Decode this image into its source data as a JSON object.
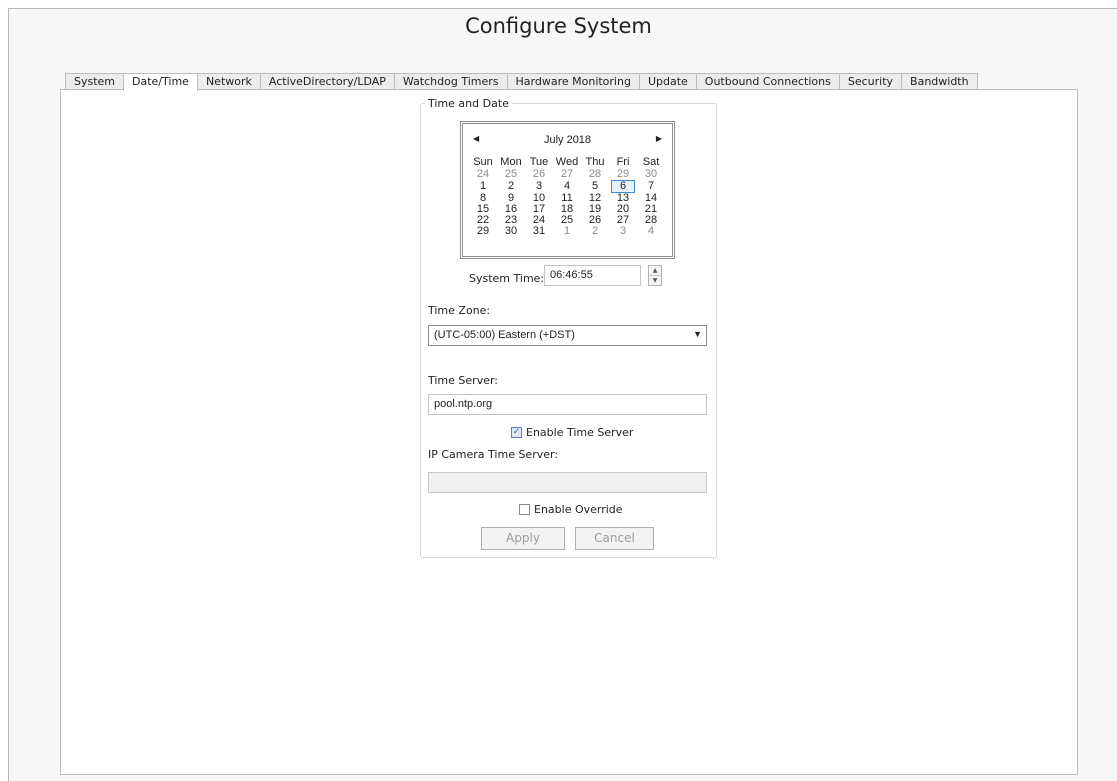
{
  "window": {
    "title": "Configure System"
  },
  "tabs": [
    {
      "label": "System",
      "active": false
    },
    {
      "label": "Date/Time",
      "active": true
    },
    {
      "label": "Network",
      "active": false
    },
    {
      "label": "ActiveDirectory/LDAP",
      "active": false
    },
    {
      "label": "Watchdog Timers",
      "active": false
    },
    {
      "label": "Hardware Monitoring",
      "active": false
    },
    {
      "label": "Update",
      "active": false
    },
    {
      "label": "Outbound Connections",
      "active": false
    },
    {
      "label": "Security",
      "active": false
    },
    {
      "label": "Bandwidth",
      "active": false
    }
  ],
  "time_date": {
    "group_label": "Time and Date",
    "calendar": {
      "month_label": "July 2018",
      "prev_glyph": "◀",
      "next_glyph": "▶",
      "weekdays": [
        "Sun",
        "Mon",
        "Tue",
        "Wed",
        "Thu",
        "Fri",
        "Sat"
      ],
      "weeks": [
        [
          {
            "d": "24",
            "o": true
          },
          {
            "d": "25",
            "o": true
          },
          {
            "d": "26",
            "o": true
          },
          {
            "d": "27",
            "o": true
          },
          {
            "d": "28",
            "o": true
          },
          {
            "d": "29",
            "o": true
          },
          {
            "d": "30",
            "o": true
          }
        ],
        [
          {
            "d": "1"
          },
          {
            "d": "2"
          },
          {
            "d": "3"
          },
          {
            "d": "4"
          },
          {
            "d": "5"
          },
          {
            "d": "6",
            "s": true
          },
          {
            "d": "7"
          }
        ],
        [
          {
            "d": "8"
          },
          {
            "d": "9"
          },
          {
            "d": "10"
          },
          {
            "d": "11"
          },
          {
            "d": "12"
          },
          {
            "d": "13"
          },
          {
            "d": "14"
          }
        ],
        [
          {
            "d": "15"
          },
          {
            "d": "16"
          },
          {
            "d": "17"
          },
          {
            "d": "18"
          },
          {
            "d": "19"
          },
          {
            "d": "20"
          },
          {
            "d": "21"
          }
        ],
        [
          {
            "d": "22"
          },
          {
            "d": "23"
          },
          {
            "d": "24"
          },
          {
            "d": "25"
          },
          {
            "d": "26"
          },
          {
            "d": "27"
          },
          {
            "d": "28"
          }
        ],
        [
          {
            "d": "29"
          },
          {
            "d": "30"
          },
          {
            "d": "31"
          },
          {
            "d": "1",
            "o": true
          },
          {
            "d": "2",
            "o": true
          },
          {
            "d": "3",
            "o": true
          },
          {
            "d": "4",
            "o": true
          }
        ]
      ]
    },
    "system_time_label": "System Time:",
    "system_time_value": "06:46:55",
    "time_zone_label": "Time Zone:",
    "time_zone_value": "(UTC-05:00) Eastern (+DST)",
    "time_server_label": "Time Server:",
    "time_server_value": "pool.ntp.org",
    "enable_time_server_label": "Enable Time Server",
    "enable_time_server_checked": true,
    "ip_camera_time_server_label": "IP Camera Time Server:",
    "ip_camera_time_server_value": "",
    "enable_override_label": "Enable Override",
    "enable_override_checked": false,
    "apply_label": "Apply",
    "cancel_label": "Cancel"
  },
  "icons": {
    "dropdown_caret": "▼",
    "spin_up": "▲",
    "spin_down": "▼",
    "check_mark": "✓"
  }
}
